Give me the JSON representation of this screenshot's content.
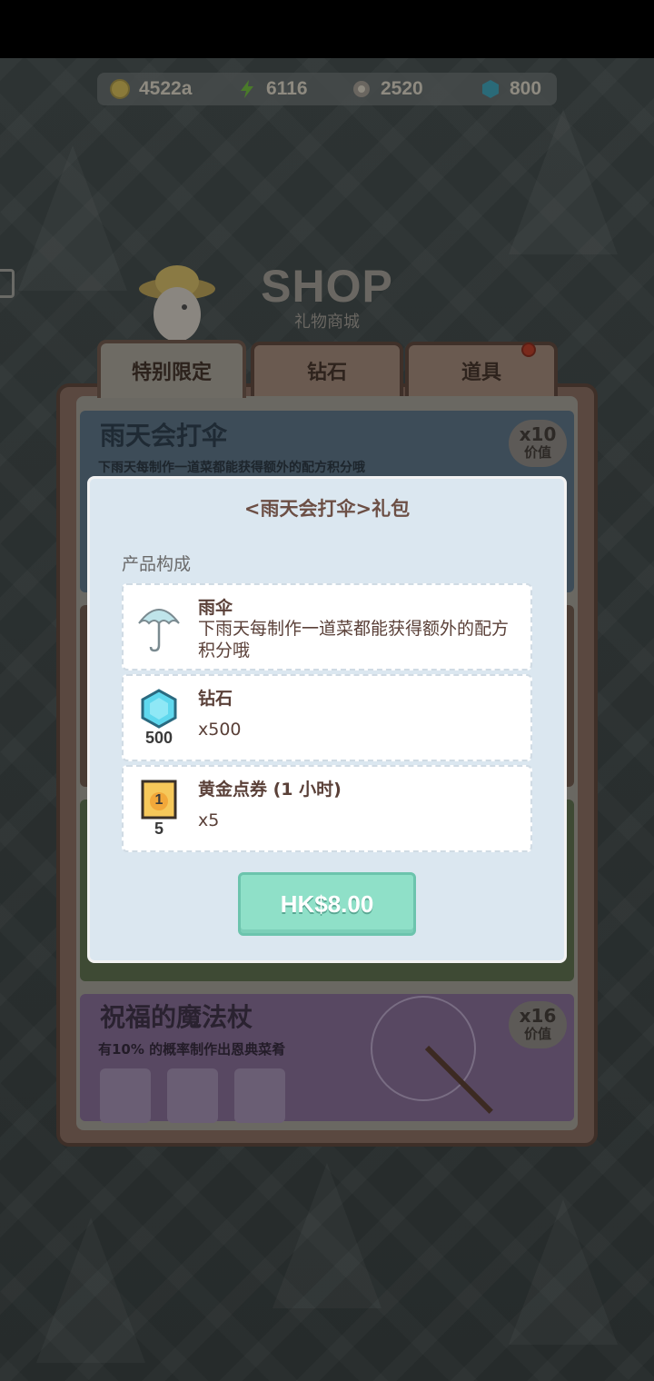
{
  "currencies": [
    {
      "icon": "coin-icon",
      "value": "4522a"
    },
    {
      "icon": "bolt-icon",
      "value": "6116"
    },
    {
      "icon": "gear-icon",
      "value": "2520"
    },
    {
      "icon": "gem-icon",
      "value": "800"
    }
  ],
  "header": {
    "title": "SHOP",
    "subtitle": "礼物商城"
  },
  "tabs": [
    {
      "label": "特别限定",
      "active": true
    },
    {
      "label": "钻石",
      "active": false
    },
    {
      "label": "道具",
      "active": false,
      "has_notification": true
    }
  ],
  "cards": {
    "rain": {
      "title": "雨天会打伞",
      "desc": "下雨天每制作一道菜都能获得额外的配方积分哦",
      "badge_mult": "x10",
      "badge_label": "价值"
    },
    "magic": {
      "title": "祝福的魔法杖",
      "desc": "有10% 的概率制作出恩典菜肴",
      "badge_mult": "x16",
      "badge_label": "价值"
    }
  },
  "dialog": {
    "title": "<雨天会打伞>礼包",
    "section_label": "产品构成",
    "items": [
      {
        "icon": "umbrella-icon",
        "name": "雨伞",
        "desc": "下雨天每制作一道菜都能获得额外的配方积分哦"
      },
      {
        "icon": "diamond-icon",
        "name": "钻石",
        "qty": "x500",
        "icon_caption": "500"
      },
      {
        "icon": "gold-ticket-icon",
        "name": "黄金点券 (1 小时)",
        "qty": "x5",
        "icon_caption": "5",
        "ticket_number": "1"
      }
    ],
    "buy_label": "HK$8.00"
  },
  "colors": {
    "buy_button": "#8fe0c8",
    "dialog_bg": "#dbe7f0",
    "title_text": "#6c4f45"
  }
}
